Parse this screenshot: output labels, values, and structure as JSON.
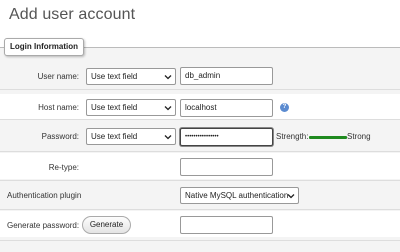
{
  "page": {
    "title": "Add user account"
  },
  "fieldset": {
    "legend": "Login Information"
  },
  "username": {
    "label": "User name:",
    "mode": "Use text field",
    "value": "db_admin"
  },
  "hostname": {
    "label": "Host name:",
    "mode": "Use text field",
    "value": "localhost",
    "help_icon": "help-icon"
  },
  "password": {
    "label": "Password:",
    "mode": "Use text field",
    "value": "••••••••••••••••",
    "strength_label": "Strength:",
    "strength_text": "Strong",
    "strength_color": "#1f8a1f",
    "strength_level": 1.0
  },
  "retype": {
    "label": "Re-type:",
    "value": ""
  },
  "auth_plugin": {
    "label": "Authentication plugin",
    "selected": "Native MySQL authentication"
  },
  "generate": {
    "label": "Generate password:",
    "button": "Generate",
    "value": ""
  }
}
